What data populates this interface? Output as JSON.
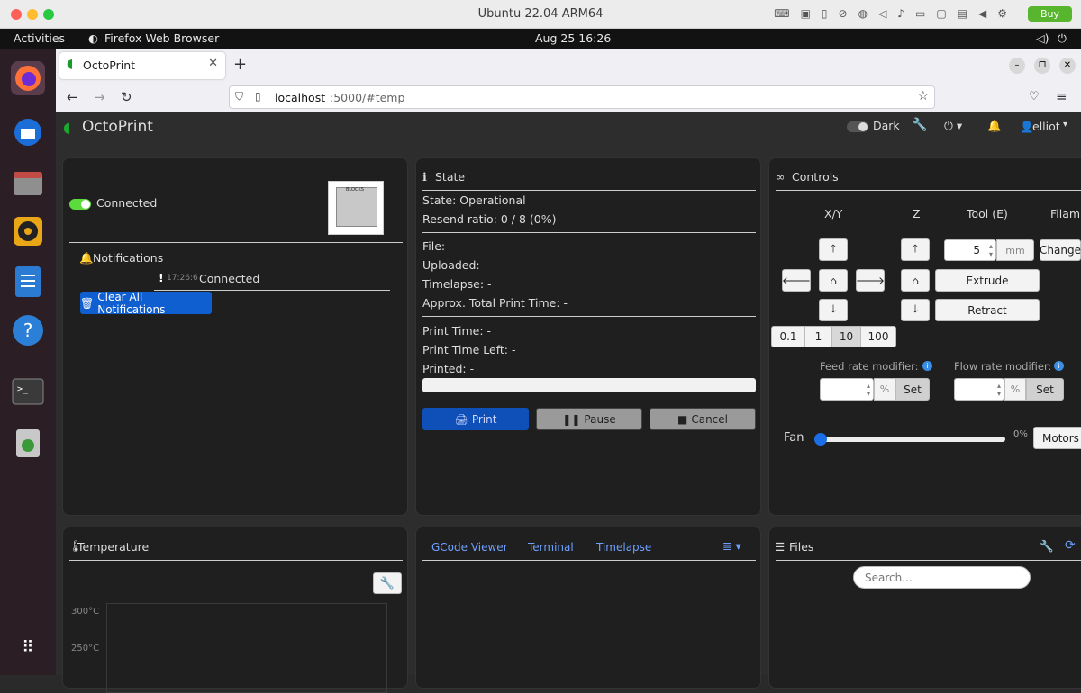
{
  "mac": {
    "title": "Ubuntu 22.04 ARM64",
    "buy": "Buy"
  },
  "gnome": {
    "activities": "Activities",
    "app": "Firefox Web Browser",
    "datetime": "Aug 25  16:26"
  },
  "browser": {
    "tab_title": "OctoPrint",
    "url_host": "localhost",
    "url_rest": ":5000/#temp"
  },
  "navbar": {
    "brand": "OctoPrint",
    "dark_label": "Dark",
    "user": "elliot"
  },
  "connection": {
    "status": "Connected",
    "notifications_title": "Notifications",
    "notif_time": "17:26:6",
    "notif_text": "Connected",
    "clear_label": "Clear All Notifications",
    "printer_label": "BLOCKS"
  },
  "state": {
    "title": "State",
    "state_line": "State: Operational",
    "resend": "Resend ratio: 0 / 8 (0%)",
    "file": "File:",
    "uploaded": "Uploaded:",
    "timelapse": "Timelapse: -",
    "approx": "Approx. Total Print Time: -",
    "print_time": "Print Time: -",
    "time_left": "Print Time Left: -",
    "printed": "Printed: -",
    "progress": 0,
    "print_btn": "Print",
    "pause_btn": "Pause",
    "cancel_btn": "Cancel"
  },
  "controls": {
    "title": "Controls",
    "col_xy": "X/Y",
    "col_z": "Z",
    "col_tool": "Tool (E)",
    "col_filament": "Filam",
    "steps": [
      "0.1",
      "1",
      "10",
      "100"
    ],
    "tool_amount": "5",
    "tool_unit": "mm",
    "change_btn": "Change",
    "extrude": "Extrude",
    "retract": "Retract",
    "feed_label": "Feed rate modifier:",
    "flow_label": "Flow rate modifier:",
    "pct": "%",
    "set": "Set",
    "fan_label": "Fan",
    "fan_value": "0%",
    "motors_btn": "Motors O"
  },
  "temperature": {
    "title": "Temperature",
    "ticks": [
      "300°C",
      "250°C"
    ]
  },
  "center_tabs": {
    "tabs": [
      "GCode Viewer",
      "Terminal",
      "Timelapse"
    ]
  },
  "files": {
    "title": "Files",
    "search_placeholder": "Search..."
  }
}
